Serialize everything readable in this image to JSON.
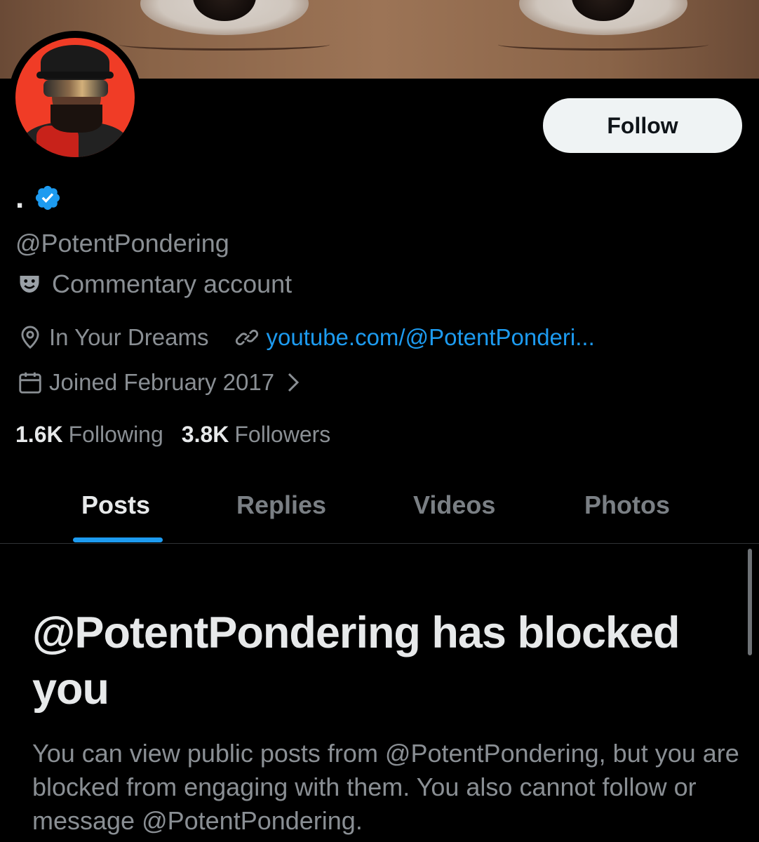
{
  "profile": {
    "display_name": ".",
    "handle": "@PotentPondering",
    "label": "Commentary account",
    "location": "In Your Dreams",
    "website": "youtube.com/@PotentPonderi...",
    "joined": "Joined February 2017",
    "following_count": "1.6K",
    "following_label": "Following",
    "followers_count": "3.8K",
    "followers_label": "Followers"
  },
  "actions": {
    "follow_label": "Follow"
  },
  "tabs": [
    {
      "label": "Posts",
      "active": true
    },
    {
      "label": "Replies",
      "active": false
    },
    {
      "label": "Videos",
      "active": false
    },
    {
      "label": "Photos",
      "active": false
    }
  ],
  "blocked": {
    "title": "@PotentPondering has blocked you",
    "description": "You can view public posts from @PotentPondering, but you are blocked from engaging with them. You also cannot follow or message @PotentPondering."
  },
  "icons": {
    "verified": "verified-badge-icon",
    "label": "theater-mask-icon",
    "location": "location-pin-icon",
    "website": "link-icon",
    "joined": "calendar-icon",
    "chevron": "chevron-right-icon"
  },
  "colors": {
    "background": "#000000",
    "accent": "#1d9bf0",
    "text_primary": "#e7e9ea",
    "text_secondary": "#8a8f94",
    "button_bg": "#eff3f4"
  }
}
